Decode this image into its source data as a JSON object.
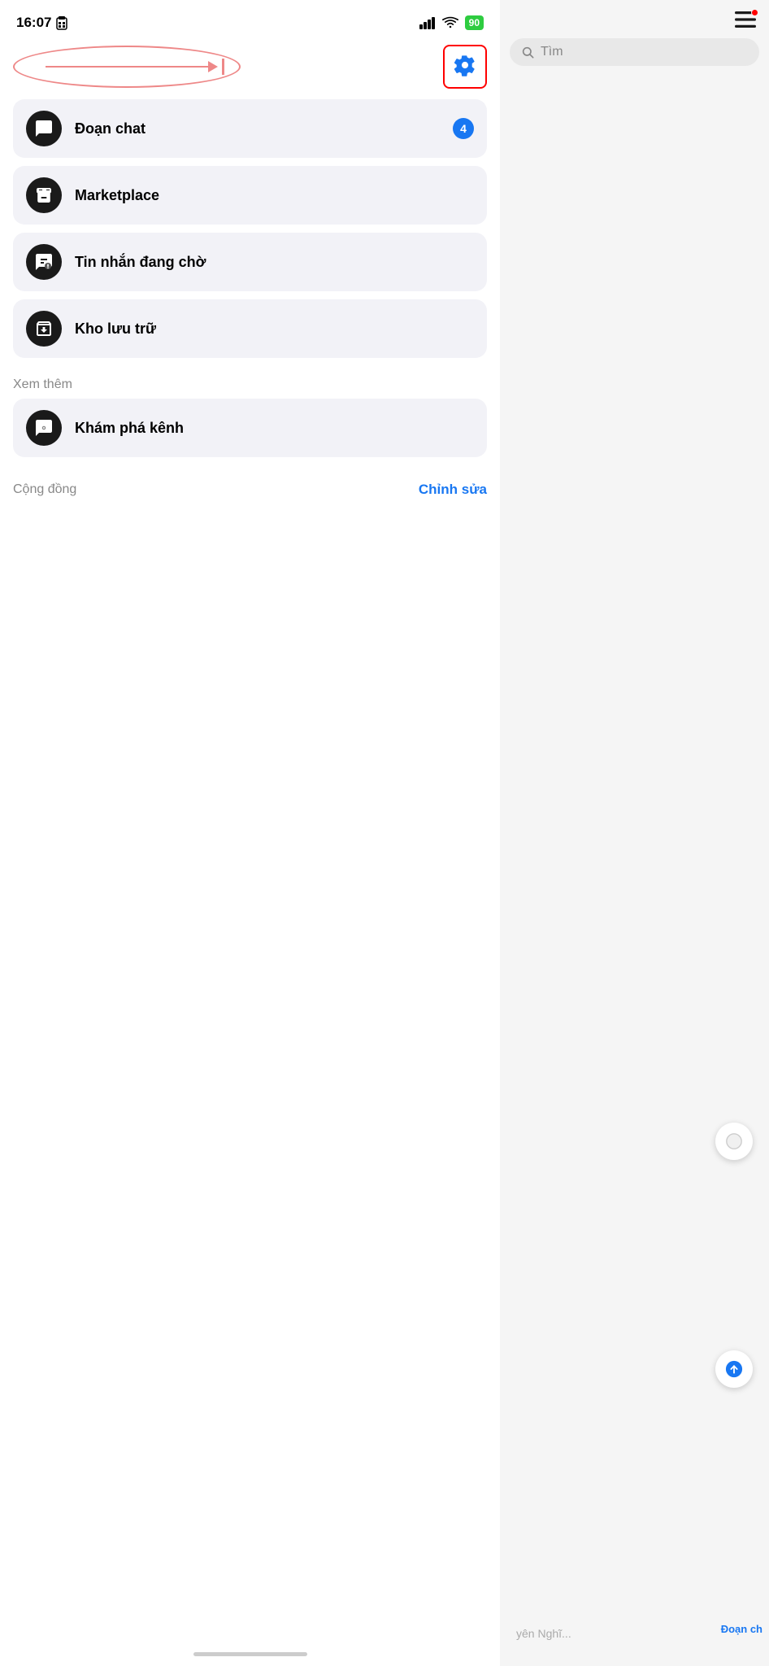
{
  "statusBar": {
    "time": "16:07",
    "battery": "90"
  },
  "header": {
    "settingsLabel": "Settings"
  },
  "menuItems": [
    {
      "id": "doan-chat",
      "label": "Đoạn chat",
      "badge": "4",
      "iconType": "chat"
    },
    {
      "id": "marketplace",
      "label": "Marketplace",
      "badge": "",
      "iconType": "marketplace"
    },
    {
      "id": "tin-nhan-dang-cho",
      "label": "Tin nhắn đang chờ",
      "badge": "",
      "iconType": "pending"
    },
    {
      "id": "kho-luu-tru",
      "label": "Kho lưu trữ",
      "badge": "",
      "iconType": "archive"
    }
  ],
  "seeMore": {
    "label": "Xem thêm"
  },
  "extraItems": [
    {
      "id": "kham-pha-kenh",
      "label": "Khám phá kênh",
      "iconType": "explore"
    }
  ],
  "community": {
    "label": "Cộng đồng",
    "editLabel": "Chỉnh sửa"
  },
  "rightPanel": {
    "searchPlaceholder": "Tìm",
    "bottomHint": "yên Nghĩ...",
    "doanChLabel": "Đoạn ch"
  }
}
